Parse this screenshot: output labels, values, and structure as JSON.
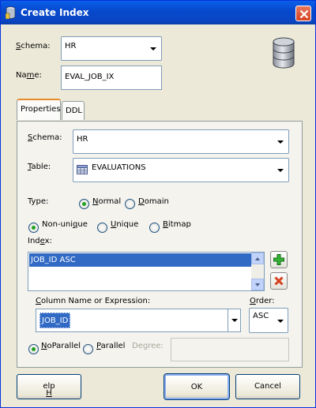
{
  "window": {
    "title": "Create Index"
  },
  "top": {
    "schema_label": "Schema:",
    "schema_value": "HR",
    "name_label": "Name:",
    "name_value": "EVAL_JOB_IX"
  },
  "tabs": [
    {
      "label": "Properties",
      "active": true
    },
    {
      "label": "DDL",
      "active": false
    }
  ],
  "properties": {
    "schema_label": "Schema:",
    "schema_value": "HR",
    "table_label": "Table:",
    "table_value": "EVALUATIONS",
    "type_label": "Type:",
    "type_options": [
      {
        "label": "Normal",
        "selected": true
      },
      {
        "label": "Domain",
        "selected": false
      }
    ],
    "uniqueness_options": [
      {
        "label": "Non-unique",
        "selected": true
      },
      {
        "label": "Unique",
        "selected": false
      },
      {
        "label": "Bitmap",
        "selected": false
      }
    ],
    "index_label": "Index:",
    "index_items": [
      "JOB_ID ASC"
    ],
    "column_label": "Column Name or Expression:",
    "column_value": "JOB_ID",
    "order_label": "Order:",
    "order_value": "ASC",
    "parallel_options": [
      {
        "label": "NoParallel",
        "selected": true
      },
      {
        "label": "Parallel",
        "selected": false
      }
    ],
    "degree_label": "Degree:",
    "degree_value": ""
  },
  "buttons": {
    "help": "Help",
    "ok": "OK",
    "cancel": "Cancel"
  },
  "colors": {
    "titlebar": "#0a5fe8",
    "selection": "#316ac5",
    "add": "#21a121",
    "remove": "#d6411f"
  },
  "icons": [
    "database-icon",
    "close-icon",
    "table-icon",
    "add-icon",
    "remove-icon"
  ]
}
